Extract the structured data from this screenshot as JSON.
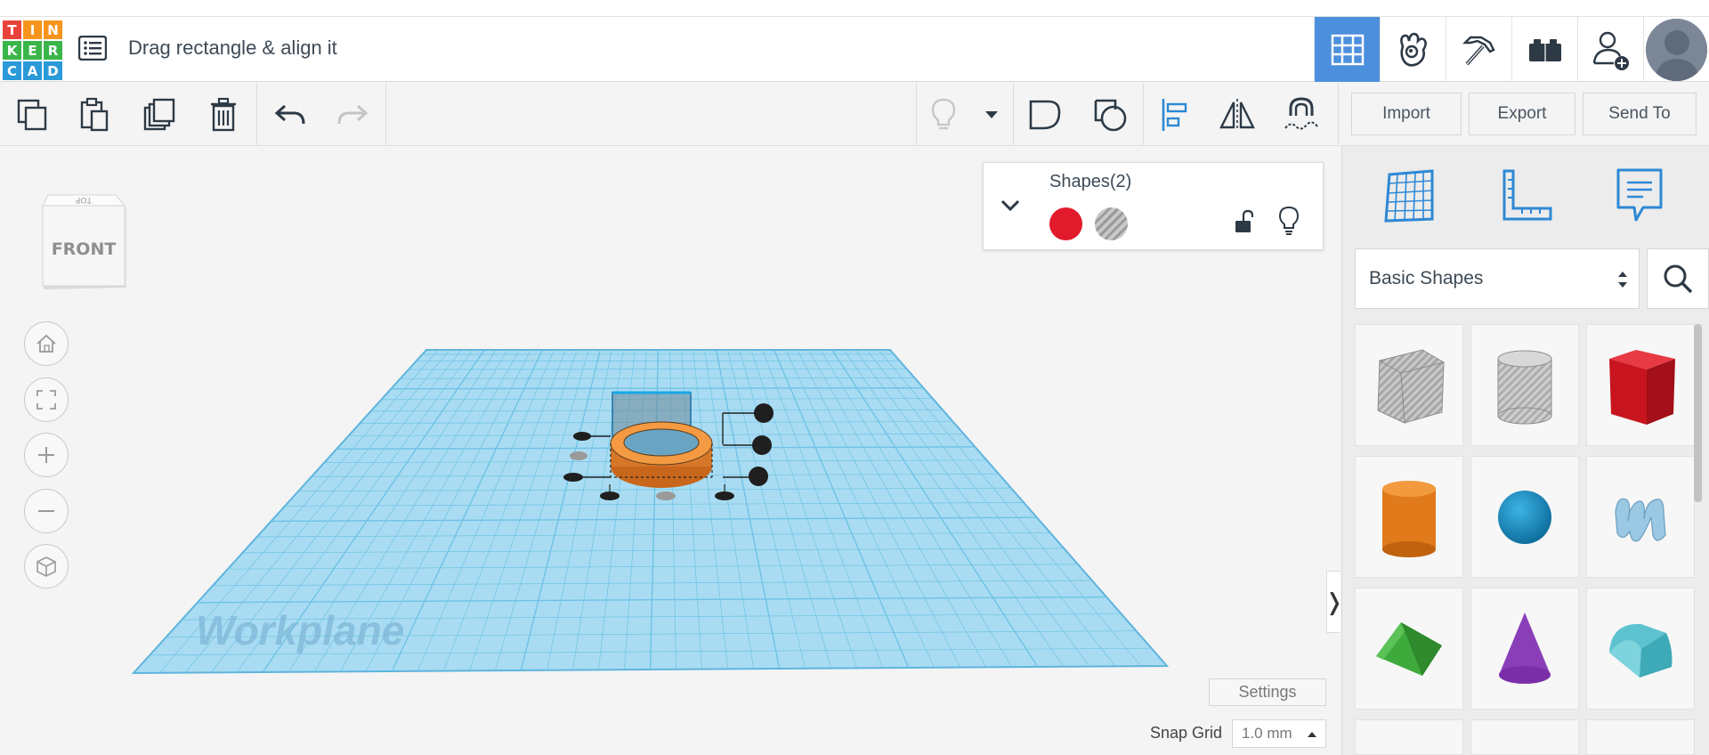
{
  "app": {
    "logo_letters": [
      "T",
      "I",
      "N",
      "K",
      "E",
      "R",
      "C",
      "A",
      "D"
    ],
    "logo_colors": [
      "#e8423a",
      "#f7941d",
      "#f7941d",
      "#3ab549",
      "#3ab549",
      "#3ab549",
      "#2a9ad9",
      "#2a9ad9",
      "#2a9ad9"
    ],
    "design_title": "Drag rectangle & align it"
  },
  "header": {
    "nav_icons": [
      "grid-view-icon",
      "blocks-icon",
      "minecraft-pickaxe-icon",
      "bricks-icon",
      "invite-user-icon"
    ],
    "active_nav": "grid-view-icon",
    "accent_color": "#4c8fdc"
  },
  "toolbar": {
    "left_icons": [
      "copy-icon",
      "paste-icon",
      "duplicate-icon",
      "delete-icon",
      "undo-icon",
      "redo-icon"
    ],
    "right_icons": [
      "bulb-icon",
      "dropdown-arrow-icon",
      "group-icon",
      "ungroup-icon",
      "align-icon",
      "mirror-icon",
      "magnet-icon"
    ],
    "import_label": "Import",
    "export_label": "Export",
    "sendto_label": "Send To"
  },
  "viewport": {
    "viewcube_top": "TOP",
    "viewcube_front": "FRONT",
    "workplane_label": "Workplane",
    "view_controls": [
      "home-icon",
      "fit-view-icon",
      "zoom-in-icon",
      "zoom-out-icon",
      "perspective-icon"
    ]
  },
  "shape_panel": {
    "title": "Shapes(2)",
    "solid_color": "#e21b2c",
    "hole_label": "hole"
  },
  "settings_label": "Settings",
  "snap_grid": {
    "label": "Snap Grid",
    "value": "1.0 mm"
  },
  "right_panel": {
    "tabs": [
      "workplane-grid-icon",
      "ruler-icon",
      "notes-icon"
    ],
    "category": "Basic Shapes",
    "shapes": [
      "box-hole-shape",
      "cylinder-hole-shape",
      "box-shape",
      "cylinder-shape",
      "sphere-shape",
      "scribble-shape",
      "roof-shape",
      "cone-shape",
      "round-roof-shape"
    ]
  }
}
